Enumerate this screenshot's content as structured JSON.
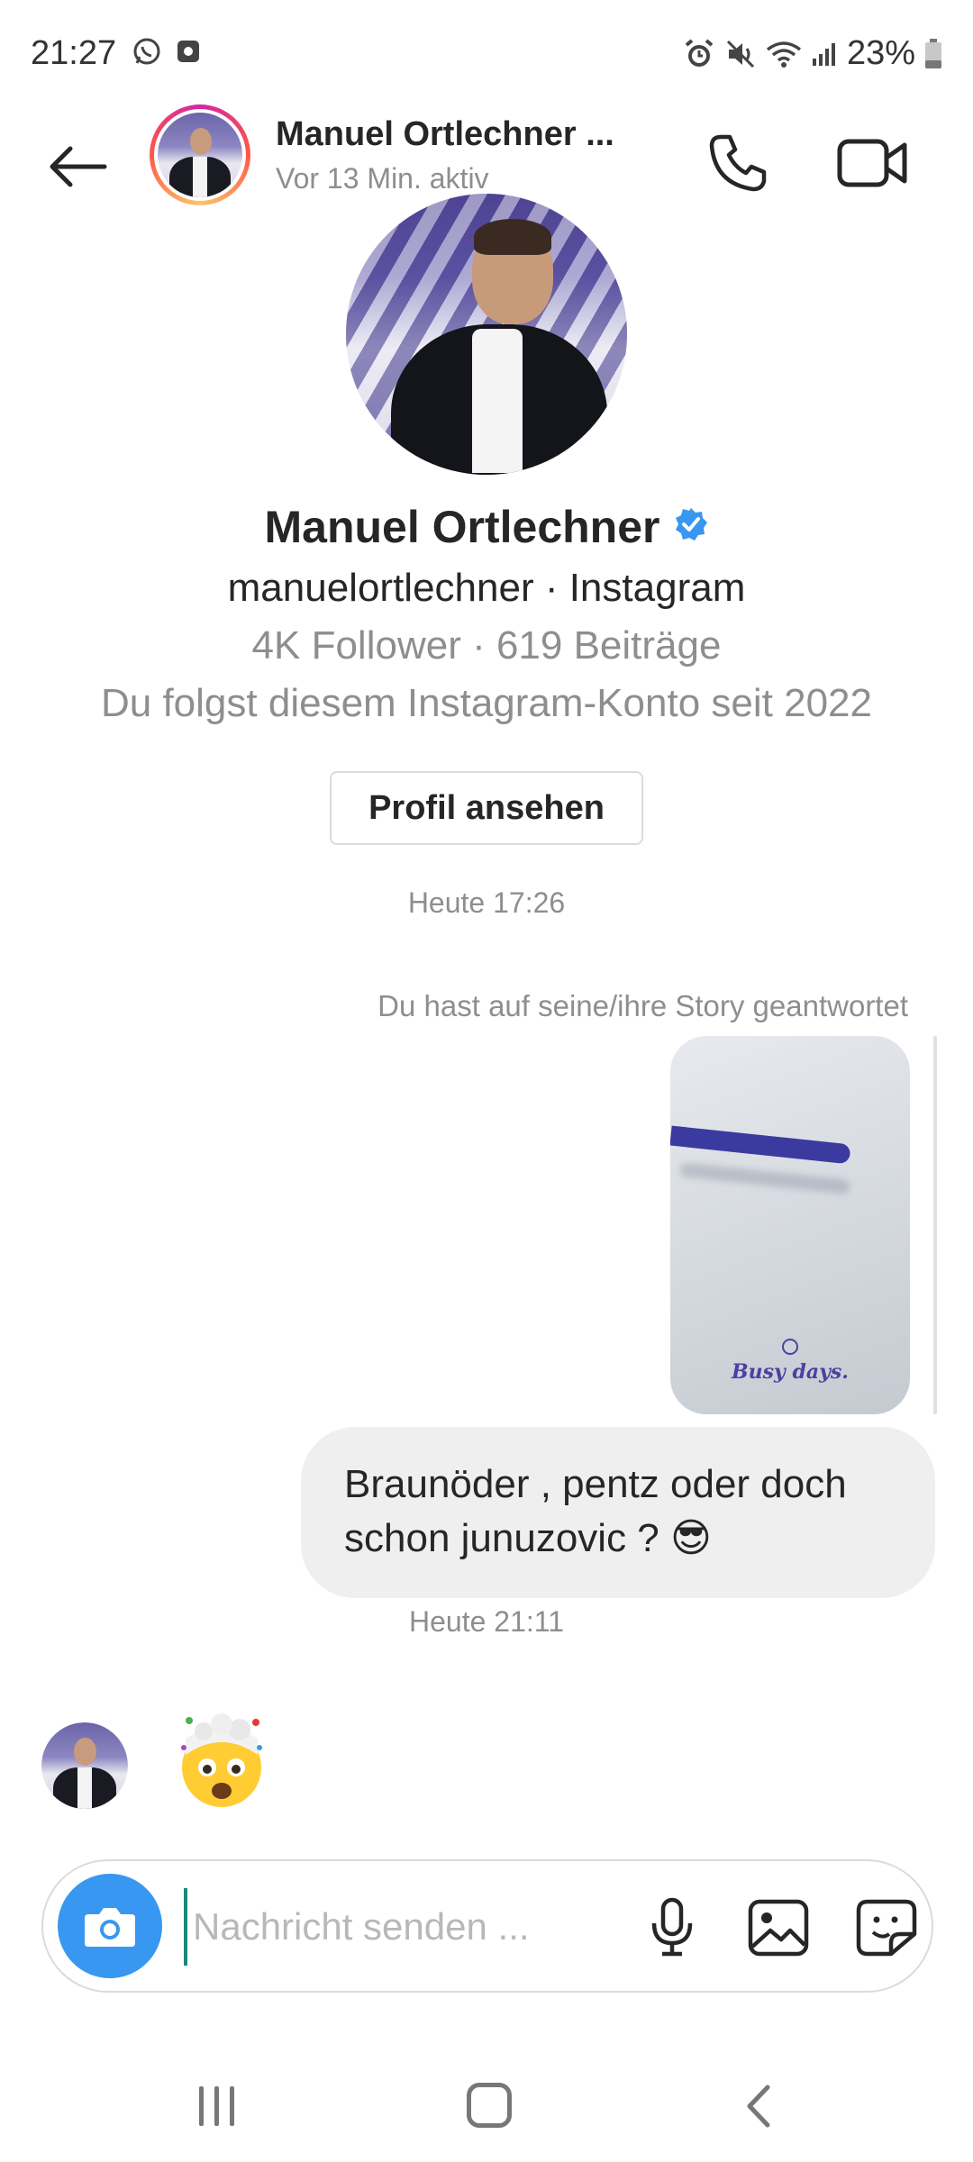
{
  "status_bar": {
    "time": "21:27",
    "battery": "23%"
  },
  "header": {
    "name": "Manuel Ortlechner ...",
    "activity": "Vor 13 Min. aktiv"
  },
  "profile": {
    "name": "Manuel Ortlechner",
    "handle": "manuelortlechner · Instagram",
    "stats": "4K Follower · 619 Beiträge",
    "follow_note": "Du folgst diesem Instagram-Konto seit 2022",
    "view_button": "Profil ansehen"
  },
  "thread": {
    "timestamp_1": "Heute 17:26",
    "story_note": "Du hast auf seine/ihre Story geantwortet",
    "story_caption": "Busy days.",
    "outgoing_message": "Braunöder , pentz oder doch schon junuzovic ? 😎",
    "timestamp_2": "Heute 21:11",
    "incoming_emoji": "🤯"
  },
  "composer": {
    "placeholder": "Nachricht senden ..."
  },
  "colors": {
    "accent_blue": "#3897f0",
    "verified_blue": "#3897f0",
    "bubble_gray": "#efefef",
    "secondary_text": "#8e8e8e"
  },
  "icons": {
    "status_left": [
      "whatsapp-icon",
      "notification-icon"
    ],
    "status_right": [
      "alarm-icon",
      "mute-icon",
      "wifi-icon",
      "signal-icon",
      "battery-icon"
    ]
  }
}
